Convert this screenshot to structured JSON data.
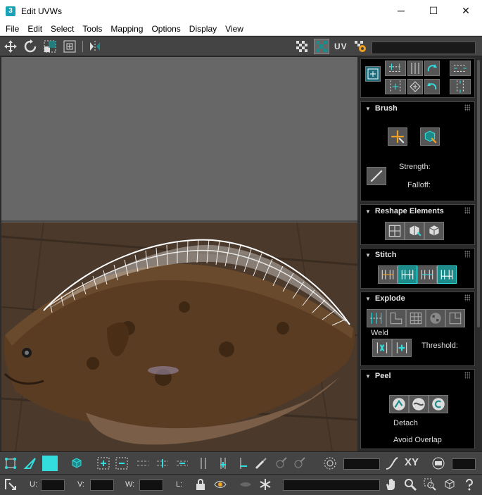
{
  "window": {
    "title": "Edit UVWs",
    "icon": "3",
    "minimize": "─",
    "maximize": "☐",
    "close": "✕"
  },
  "menu": [
    "File",
    "Edit",
    "Select",
    "Tools",
    "Mapping",
    "Options",
    "Display",
    "View"
  ],
  "toolbar": {
    "uv_label": "UV"
  },
  "panels": {
    "brush": {
      "title": "Brush",
      "strength_label": "Strength:",
      "falloff_label": "Falloff:"
    },
    "reshape": {
      "title": "Reshape Elements"
    },
    "stitch": {
      "title": "Stitch"
    },
    "explode": {
      "title": "Explode",
      "weld_label": "Weld",
      "threshold_label": "Threshold:"
    },
    "peel": {
      "title": "Peel",
      "detach_label": "Detach",
      "avoid_overlap_label": "Avoid Overlap"
    }
  },
  "bottom": {
    "xy_label": "XY",
    "u_label": "U:",
    "v_label": "V:",
    "w_label": "W:",
    "l_label": "L:"
  },
  "colors": {
    "accent": "#1e8b8b",
    "panel_bg": "#000000",
    "toolbar_bg": "#444444"
  }
}
